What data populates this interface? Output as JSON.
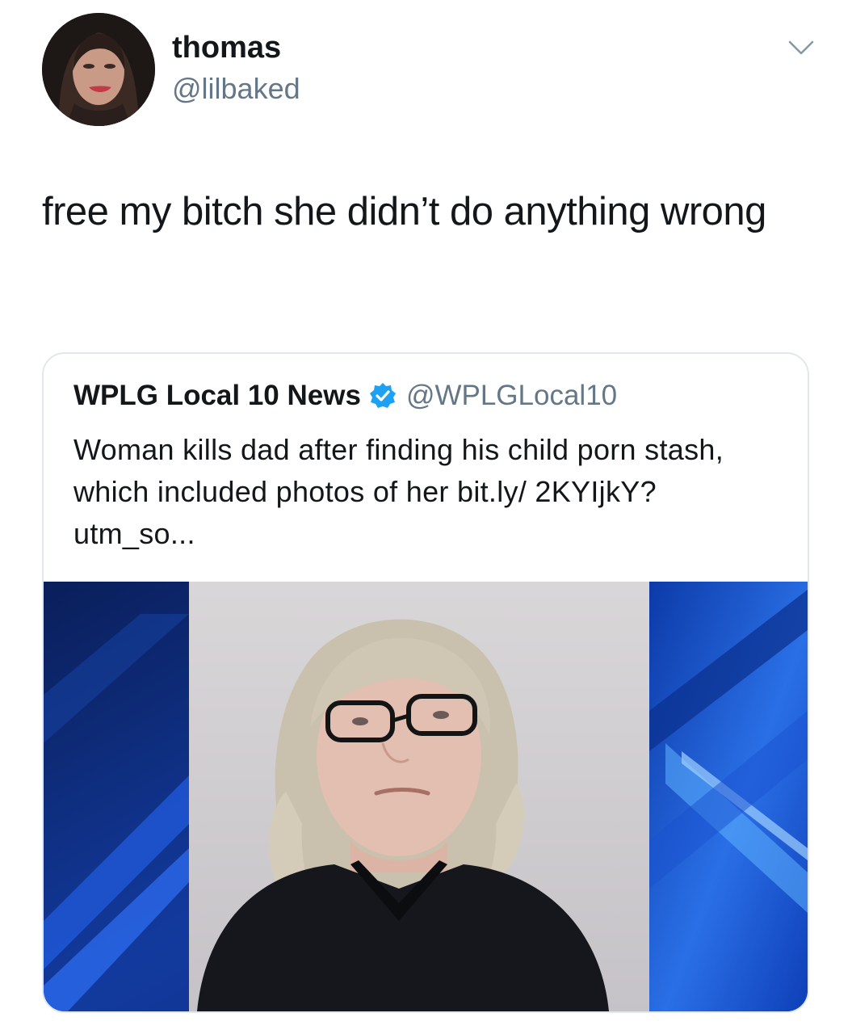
{
  "tweet": {
    "author": {
      "display_name": "thomas",
      "handle": "@lilbaked",
      "avatar_icon": "profile-photo"
    },
    "menu_icon": "chevron-down-icon",
    "text": "free my bitch she didn’t do anything wrong"
  },
  "quoted_tweet": {
    "author": {
      "display_name": "WPLG Local 10 News",
      "handle": "@WPLGLocal10",
      "verified": true,
      "verified_icon": "verified-badge-icon"
    },
    "text": "Woman kills dad after finding his child porn stash, which included photos of her bit.ly/ 2KYIjkY?utm_so...",
    "media": {
      "type": "photo",
      "background_accent": "#1e56d6"
    }
  },
  "colors": {
    "primary_text": "#14171a",
    "secondary_text": "#657786",
    "verified_blue": "#1da1f2",
    "card_border": "#e1e8ed"
  }
}
